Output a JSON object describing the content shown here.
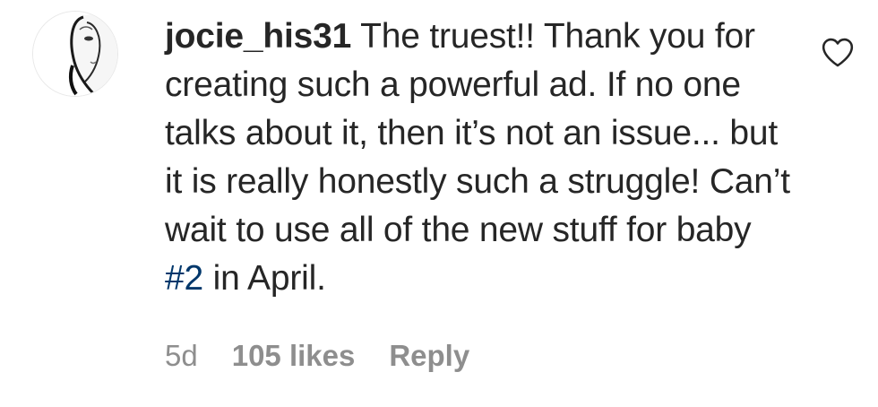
{
  "comment": {
    "username": "jocie_his31",
    "text_before_tag": "The truest!! Thank you for creating such a powerful ad. If no one talks about it, then it’s not an issue... but it is really honestly such a struggle! Can’t wait to use all of the new stuff for baby ",
    "hashtag": "#2",
    "text_after_tag": " in April.",
    "timestamp": "5d",
    "likes": "105 likes",
    "reply_label": "Reply"
  },
  "icons": {
    "like": "heart-outline-icon",
    "avatar": "profile-photo"
  },
  "colors": {
    "text": "#262626",
    "hashtag": "#00376b",
    "meta": "#8e8e8e"
  }
}
